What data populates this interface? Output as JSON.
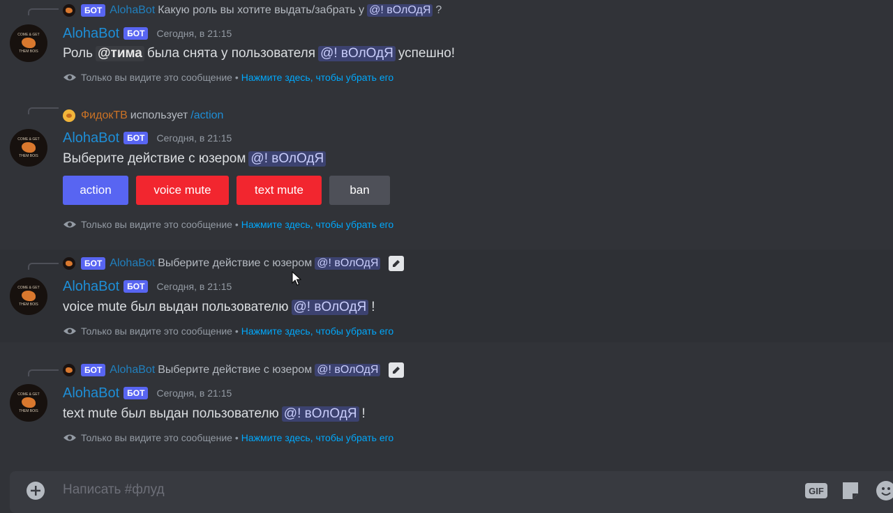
{
  "bot_badge": "БОТ",
  "ephemeral_notice": "Только вы видите это сообщение •",
  "dismiss_link": "Нажмите здесь, чтобы убрать его",
  "messages": [
    {
      "reply_author": "AlohaBot",
      "reply_text": "Какую роль вы хотите выдать/забрать у",
      "reply_mention": "@! вОлОдЯ",
      "reply_suffix": "?",
      "author": "AlohaBot",
      "timestamp": "Сегодня, в 21:15",
      "content_pre": "Роль",
      "role_mention": "@тима",
      "content_mid": "была снята у пользователя",
      "user_mention": "@! вОлОдЯ",
      "content_post": "успешно!"
    },
    {
      "reply_author": "ФидокТВ",
      "reply_text": "использует",
      "reply_command": "/action",
      "author": "AlohaBot",
      "timestamp": "Сегодня, в 21:15",
      "content_pre": "Выберите действие с юзером",
      "user_mention": "@! вОлОдЯ",
      "buttons": [
        "action",
        "voice mute",
        "text mute",
        "ban"
      ]
    },
    {
      "reply_author": "AlohaBot",
      "reply_text": "Выберите действие с юзером",
      "reply_mention": "@! вОлОдЯ",
      "author": "AlohaBot",
      "timestamp": "Сегодня, в 21:15",
      "content_pre": "voice mute был выдан пользователю",
      "user_mention": "@! вОлОдЯ",
      "content_post": "!"
    },
    {
      "reply_author": "AlohaBot",
      "reply_text": "Выберите действие с юзером",
      "reply_mention": "@! вОлОдЯ",
      "author": "AlohaBot",
      "timestamp": "Сегодня, в 21:15",
      "content_pre": "text mute был выдан пользователю",
      "user_mention": "@! вОлОдЯ",
      "content_post": "!"
    }
  ],
  "avatar_text": {
    "top": "COME & GET",
    "bottom": "THEM BOIS"
  },
  "composer": {
    "placeholder": "Написать #флуд",
    "gif_label": "GIF"
  },
  "colors": {
    "background": "#313338",
    "blurple": "#5865f2",
    "danger": "#f2262f",
    "secondary": "#4e5058",
    "link": "#00a8fc",
    "author": "#1e8ed6"
  }
}
